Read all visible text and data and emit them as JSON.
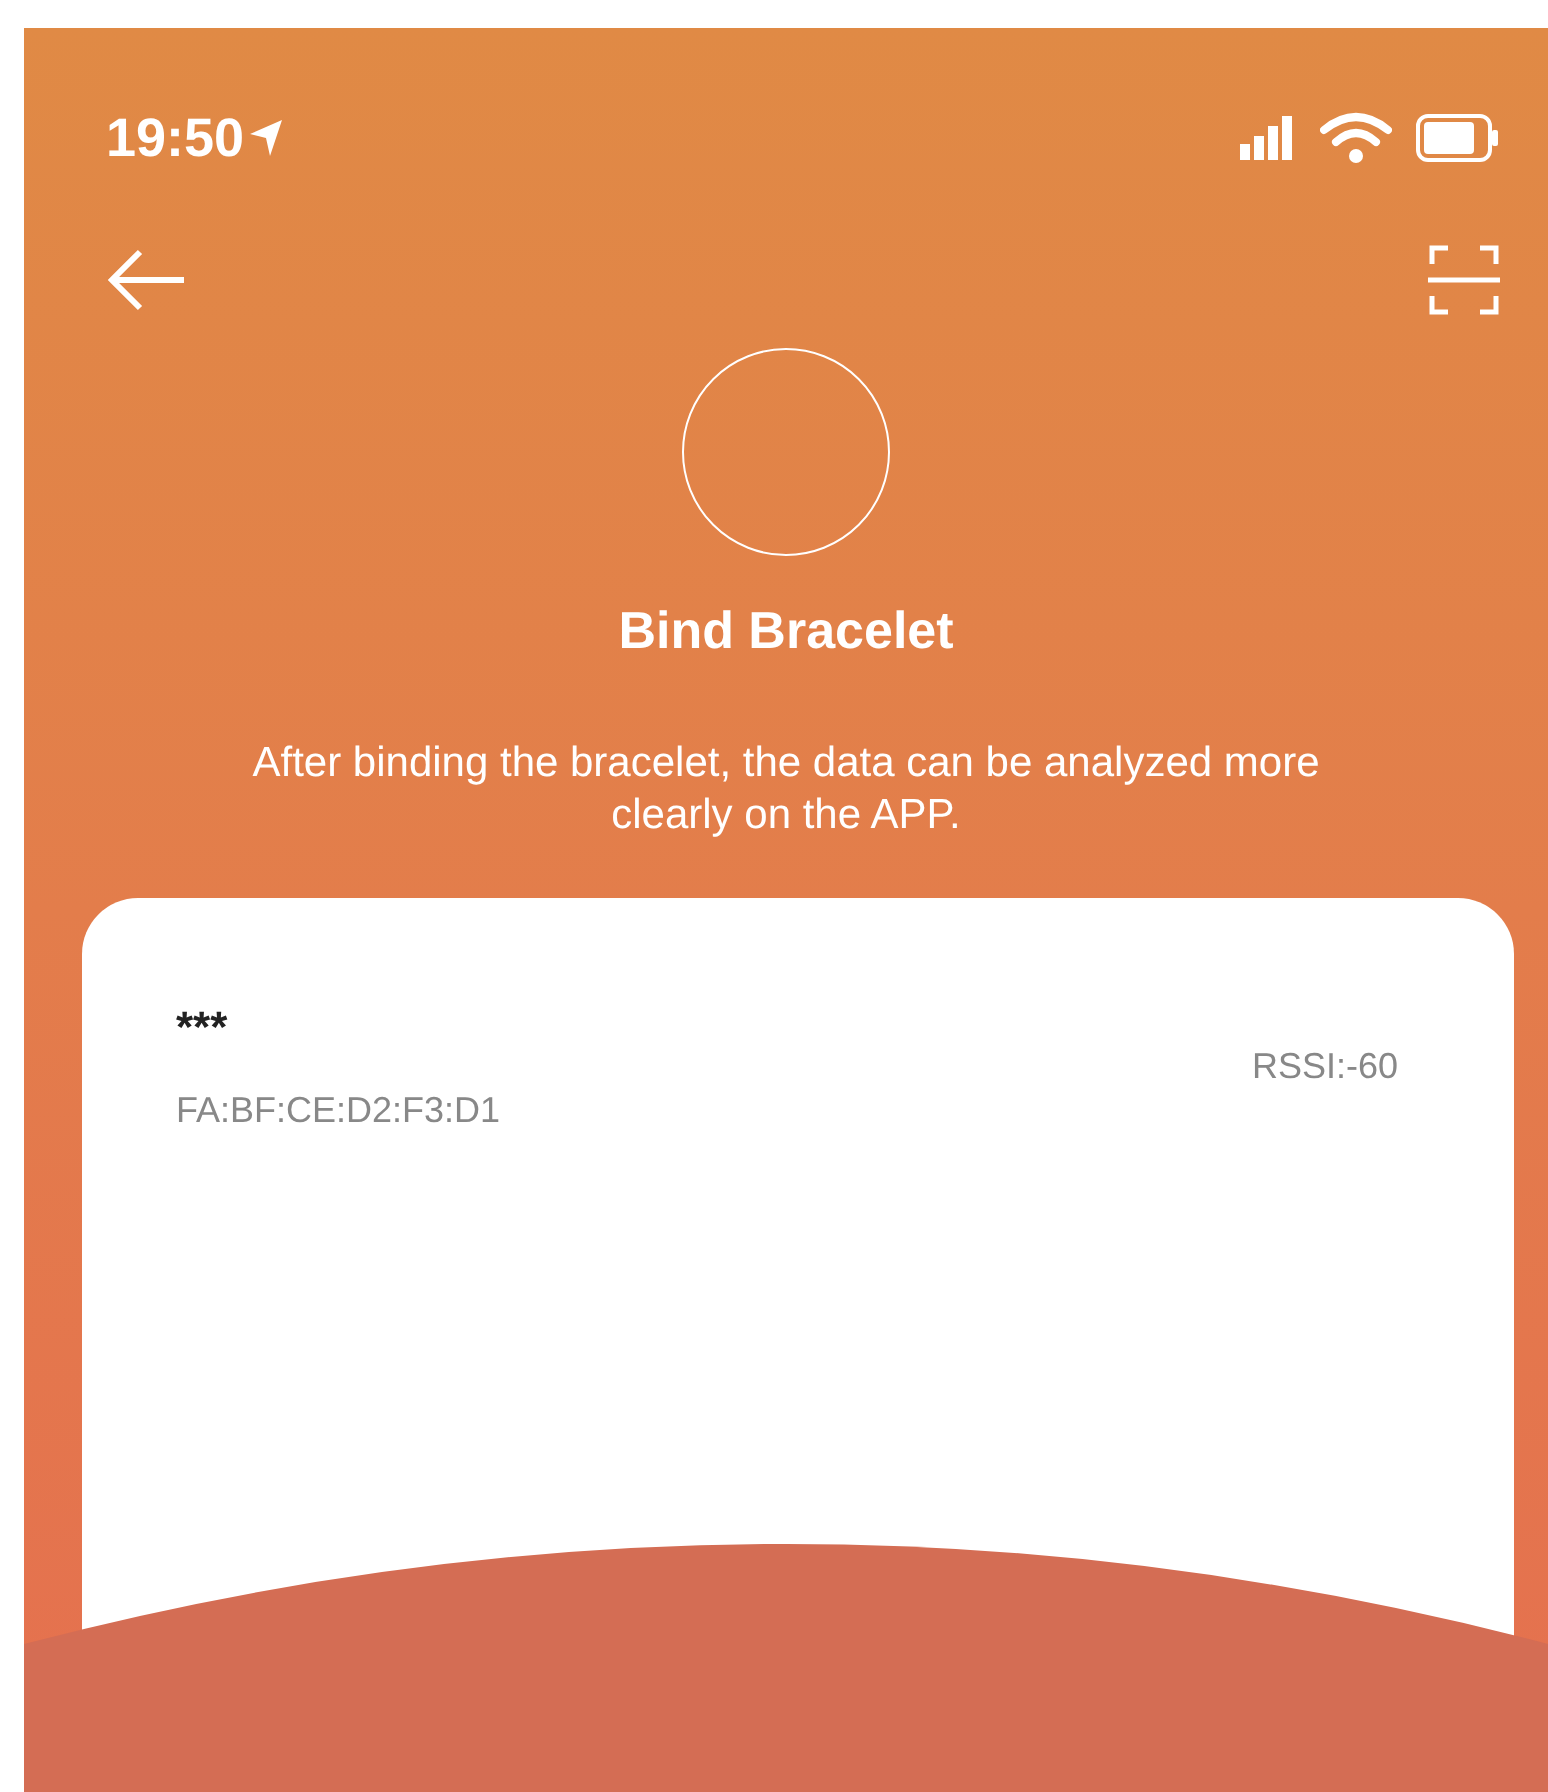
{
  "status_bar": {
    "time": "19:50"
  },
  "header": {
    "title": "Bind Bracelet",
    "description": "After binding the bracelet, the data can be analyzed more clearly on the APP."
  },
  "devices": [
    {
      "name": "***",
      "mac": "FA:BF:CE:D2:F3:D1",
      "rssi": "RSSI:-60"
    }
  ]
}
